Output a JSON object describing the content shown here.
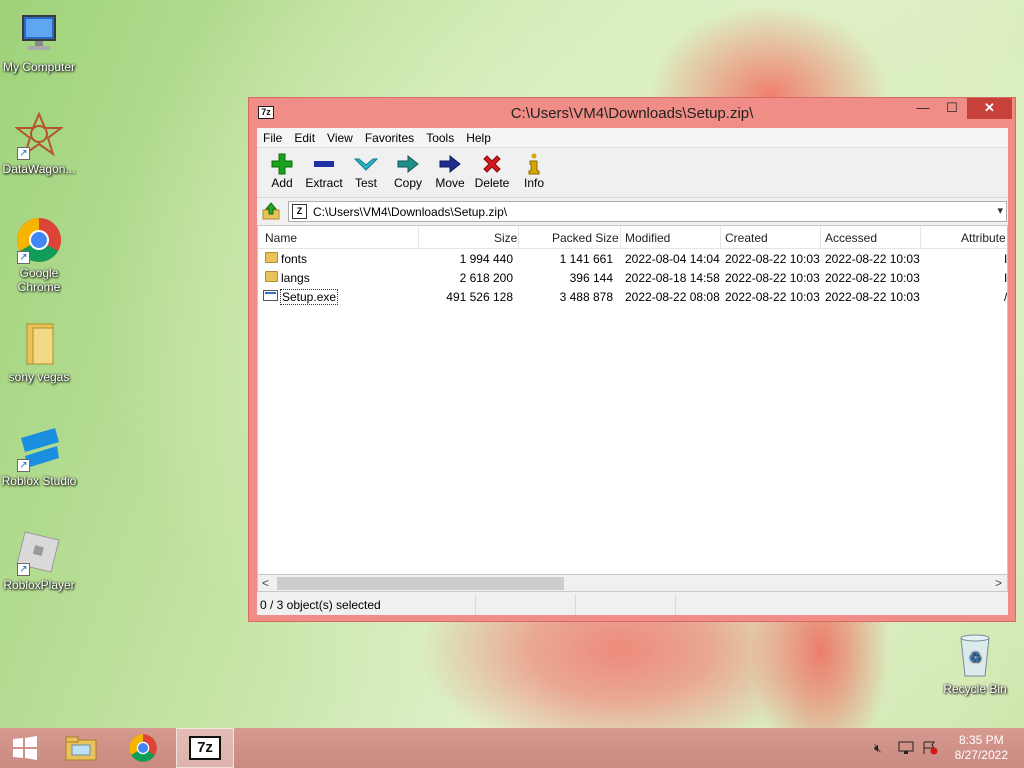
{
  "desktop": {
    "icons": [
      {
        "label": "My Computer"
      },
      {
        "label": "DataWagon..."
      },
      {
        "label": "Google Chrome"
      },
      {
        "label": "sony vegas"
      },
      {
        "label": "Roblox Studio"
      },
      {
        "label": "RobloxPlayer"
      },
      {
        "label": "Recycle Bin"
      }
    ]
  },
  "window": {
    "title": "C:\\Users\\VM4\\Downloads\\Setup.zip\\",
    "app_icon_text": "7z",
    "menu": [
      "File",
      "Edit",
      "View",
      "Favorites",
      "Tools",
      "Help"
    ],
    "toolbar": [
      {
        "label": "Add",
        "icon": "plus-icon",
        "color": "#1aa31a"
      },
      {
        "label": "Extract",
        "icon": "minus-icon",
        "color": "#1e2fa8"
      },
      {
        "label": "Test",
        "icon": "check-icon",
        "color": "#2bb5c8"
      },
      {
        "label": "Copy",
        "icon": "copy-arrow-icon",
        "color": "#1e8f86"
      },
      {
        "label": "Move",
        "icon": "move-arrow-icon",
        "color": "#1e2f8f"
      },
      {
        "label": "Delete",
        "icon": "delete-x-icon",
        "color": "#d21a1a"
      },
      {
        "label": "Info",
        "icon": "info-icon",
        "color": "#d7a800"
      }
    ],
    "address": "C:\\Users\\VM4\\Downloads\\Setup.zip\\",
    "columns": [
      "Name",
      "Size",
      "Packed Size",
      "Modified",
      "Created",
      "Accessed",
      "Attribute"
    ],
    "rows": [
      {
        "name": "fonts",
        "size": "1 994 440",
        "packed": "1 141 661",
        "modified": "2022-08-04 14:04",
        "created": "2022-08-22 10:03",
        "accessed": "2022-08-22 10:03",
        "attr": "I",
        "type": "folder"
      },
      {
        "name": "langs",
        "size": "2 618 200",
        "packed": "396 144",
        "modified": "2022-08-18 14:58",
        "created": "2022-08-22 10:03",
        "accessed": "2022-08-22 10:03",
        "attr": "I",
        "type": "folder"
      },
      {
        "name": "Setup.exe",
        "size": "491 526 128",
        "packed": "3 488 878",
        "modified": "2022-08-22 08:08",
        "created": "2022-08-22 10:03",
        "accessed": "2022-08-22 10:03",
        "attr": "/",
        "type": "exe"
      }
    ],
    "status": "0 / 3 object(s) selected"
  },
  "taskbar": {
    "time": "8:35 PM",
    "date": "8/27/2022",
    "sevenzip_label": "7z"
  }
}
